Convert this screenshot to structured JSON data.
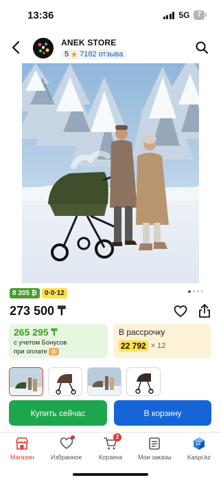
{
  "status_bar": {
    "time": "13:36",
    "network": "5G",
    "battery": "7"
  },
  "store": {
    "name": "ANEK STORE",
    "rating": "5",
    "reviews": "7182 отзыва",
    "icons": {
      "back": "chevron-left-icon",
      "search": "search-icon",
      "rating": "star-icon"
    }
  },
  "product": {
    "image_icon": "family-stroller-winter-photo",
    "badges": [
      "8 205 ₿",
      "0·0·12"
    ],
    "price": "273 500 ₸",
    "carousel": {
      "count": 4,
      "active": 0
    }
  },
  "bonus": {
    "price": "265 295 ₸",
    "line1": "с учетом Бонусов",
    "line2": "при оплате"
  },
  "installment": {
    "title": "В рассрочку",
    "amount": "22 792",
    "months": "× 12"
  },
  "thumbnails": [
    "photo-family-icon",
    "photo-stroller-icon",
    "photo-family-icon",
    "photo-stroller-icon"
  ],
  "actions": {
    "buy": "Купить сейчас",
    "cart": "В корзину"
  },
  "tabs": [
    {
      "label": "Магазин",
      "icon": "store-icon",
      "active": true
    },
    {
      "label": "Избранное",
      "icon": "heart-icon",
      "active": false
    },
    {
      "label": "Корзина",
      "icon": "cart-icon",
      "badge": "2",
      "active": false
    },
    {
      "label": "Мои заказы",
      "icon": "orders-icon",
      "active": false
    },
    {
      "label": "Kaspi.kz",
      "icon": "kaspi-app-icon",
      "active": false
    }
  ],
  "colors": {
    "accent_red": "#e03a2f",
    "buy_green": "#1ea64e",
    "cart_blue": "#1565d8",
    "bonus_green": "#3d9a22",
    "badge_yellow": "#ffe04a"
  }
}
